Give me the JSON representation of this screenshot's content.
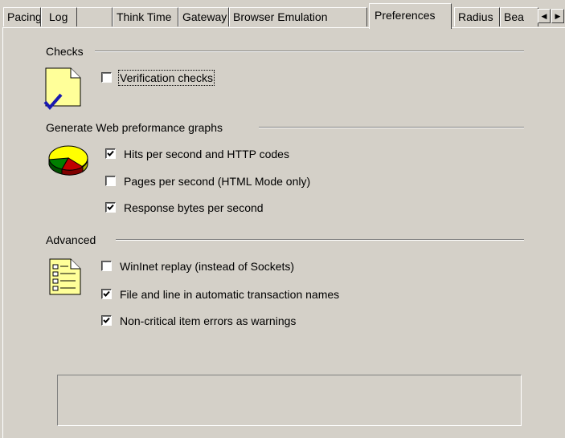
{
  "tabs": [
    {
      "label": "Pacing",
      "active": false
    },
    {
      "label": "Log",
      "active": false
    },
    {
      "label": "Think Time",
      "active": false
    },
    {
      "label": "Gateway",
      "active": false
    },
    {
      "label": "Browser Emulation",
      "active": false
    },
    {
      "label": "Preferences",
      "active": true
    },
    {
      "label": "Radius",
      "active": false
    },
    {
      "label": "Bea",
      "active": false
    }
  ],
  "scroll": {
    "left": "◀",
    "right": "▶"
  },
  "groups": {
    "checks": {
      "title": "Checks",
      "icon": "document-check-icon",
      "items": [
        {
          "label": "Verification checks",
          "checked": false
        }
      ]
    },
    "graphs": {
      "title": "Generate Web preformance graphs",
      "icon": "pie-chart-icon",
      "items": [
        {
          "label": "Hits per second and HTTP codes",
          "checked": true
        },
        {
          "label": "Pages per second (HTML Mode only)",
          "checked": false
        },
        {
          "label": "Response bytes per second",
          "checked": true
        }
      ]
    },
    "advanced": {
      "title": "Advanced",
      "icon": "checklist-icon",
      "items": [
        {
          "label": "WinInet replay (instead of Sockets)",
          "checked": false
        },
        {
          "label": "File and line in automatic transaction names",
          "checked": true
        },
        {
          "label": "Non-critical item errors as warnings",
          "checked": true
        }
      ]
    }
  },
  "colors": {
    "face": "#d4d0c8",
    "shadow": "#808080",
    "highlight": "#ffffff",
    "note_yellow": "#ffff99",
    "check_blue": "#0000cc"
  }
}
